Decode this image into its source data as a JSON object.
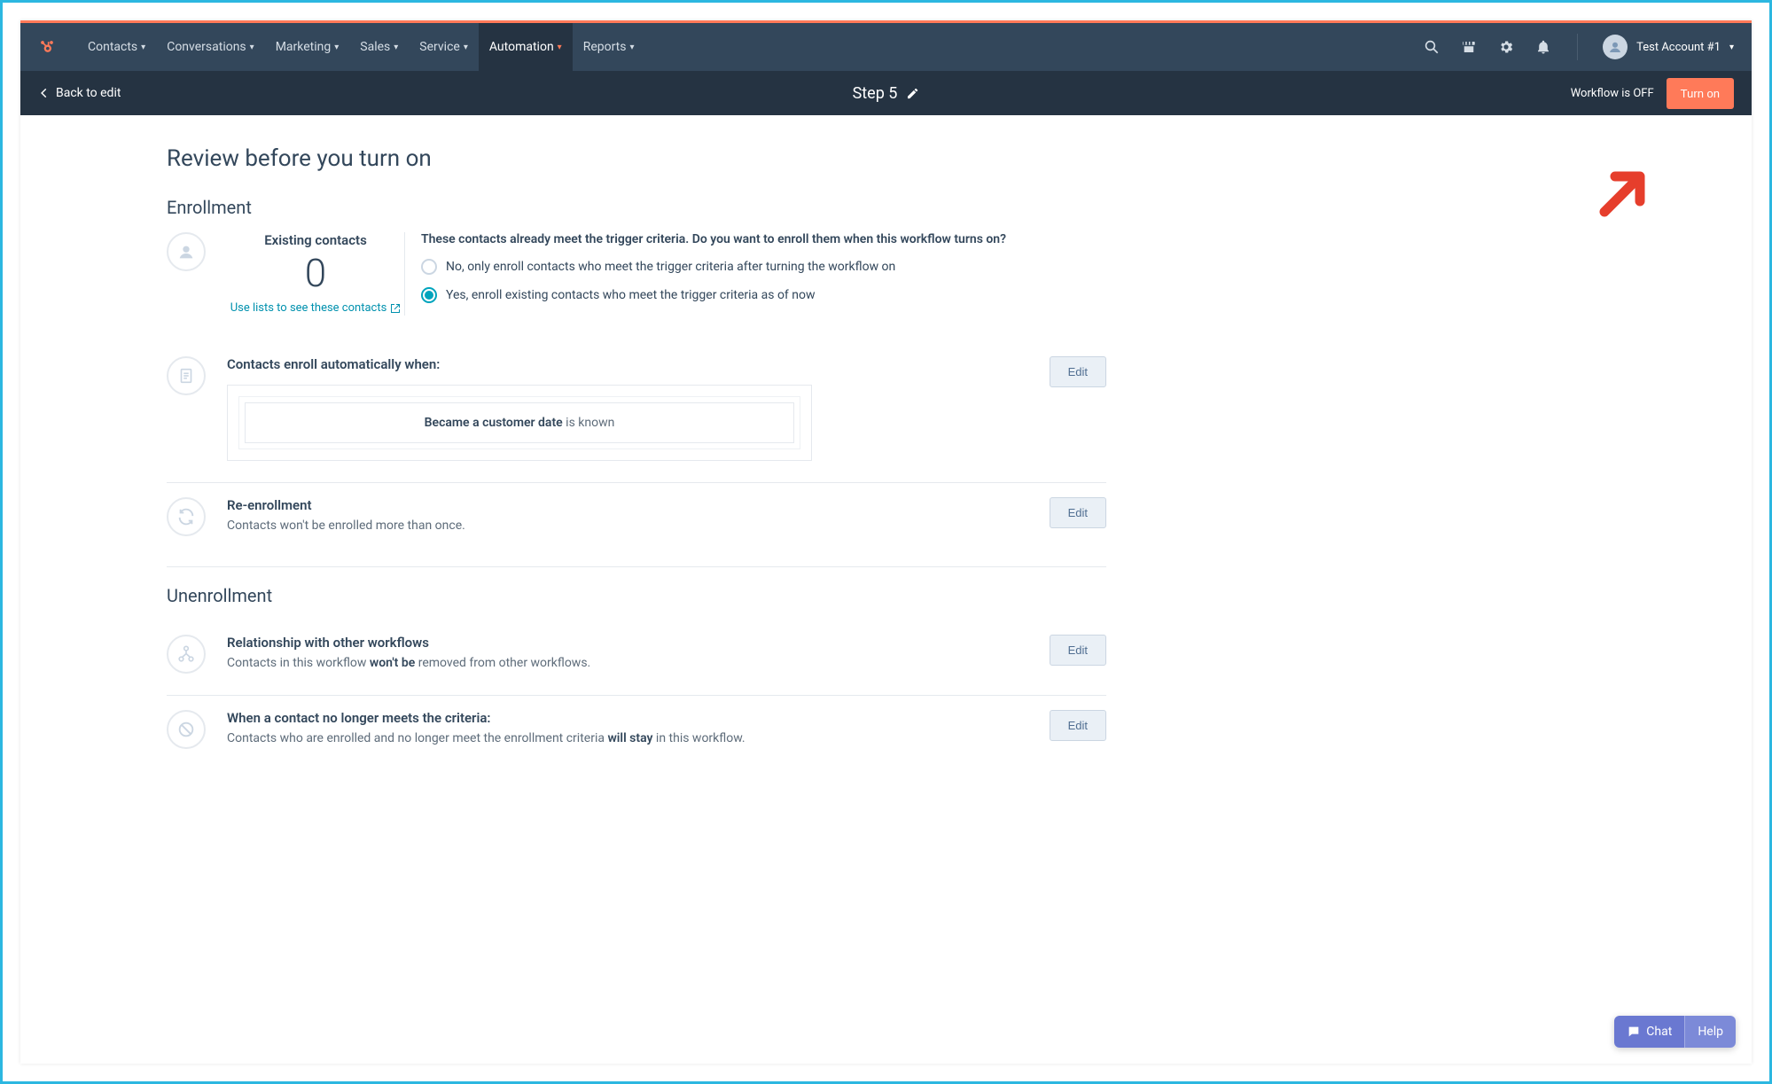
{
  "nav": {
    "items": [
      {
        "label": "Contacts",
        "active": false
      },
      {
        "label": "Conversations",
        "active": false
      },
      {
        "label": "Marketing",
        "active": false
      },
      {
        "label": "Sales",
        "active": false
      },
      {
        "label": "Service",
        "active": false
      },
      {
        "label": "Automation",
        "active": true
      },
      {
        "label": "Reports",
        "active": false
      }
    ],
    "account_name": "Test Account #1"
  },
  "subnav": {
    "back_label": "Back to edit",
    "title": "Step 5",
    "status_text": "Workflow is OFF",
    "turn_on_label": "Turn on"
  },
  "page": {
    "heading": "Review before you turn on",
    "enrollment_heading": "Enrollment",
    "unenrollment_heading": "Unenrollment"
  },
  "enrollment": {
    "existing_label": "Existing contacts",
    "existing_count": "0",
    "lists_link": "Use lists to see these contacts",
    "prompt": "These contacts already meet the trigger criteria. Do you want to enroll them when this workflow turns on?",
    "option_no": "No, only enroll contacts who meet the trigger criteria after turning the workflow on",
    "option_yes": "Yes, enroll existing contacts who meet the trigger criteria as of now",
    "selected": "yes"
  },
  "trigger": {
    "title": "Contacts enroll automatically when:",
    "criteria_bold": "Became a customer date",
    "criteria_rest": " is known",
    "edit_label": "Edit"
  },
  "reenrollment": {
    "title": "Re-enrollment",
    "desc": "Contacts won't be enrolled more than once.",
    "edit_label": "Edit"
  },
  "relationship": {
    "title": "Relationship with other workflows",
    "desc_pre": "Contacts in this workflow ",
    "desc_bold": "won't be",
    "desc_post": " removed from other workflows.",
    "edit_label": "Edit"
  },
  "no_longer_meets": {
    "title": "When a contact no longer meets the criteria:",
    "desc_pre": "Contacts who are enrolled and no longer meet the enrollment criteria ",
    "desc_bold": "will stay",
    "desc_post": " in this workflow.",
    "edit_label": "Edit"
  },
  "chat": {
    "chat_label": "Chat",
    "help_label": "Help"
  }
}
